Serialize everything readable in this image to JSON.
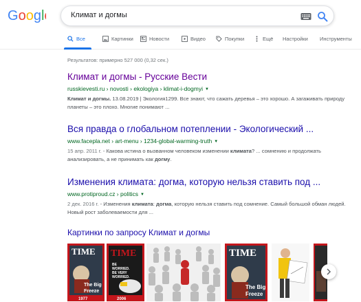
{
  "search": {
    "query": "Климат и догмы"
  },
  "tabs": [
    {
      "label": "Все",
      "icon": "search-icon"
    },
    {
      "label": "Картинки",
      "icon": "image-icon"
    },
    {
      "label": "Новости",
      "icon": "news-icon"
    },
    {
      "label": "Видео",
      "icon": "video-icon"
    },
    {
      "label": "Покупки",
      "icon": "tag-icon"
    },
    {
      "label": "Ещё",
      "icon": "more-icon"
    },
    {
      "label": "Настройки"
    },
    {
      "label": "Инструменты"
    }
  ],
  "stats": "Результатов: примерно 527 000 (0,32 сек.)",
  "results": [
    {
      "title": "Климат и догмы - Русские Вести",
      "url": "russkievesti.ru › novosti › ekologiya › klimat-i-dogmyi",
      "snippet_bold": "Климат и догмы.",
      "snippet": " 13.08.2019 | Экология1299. Все знают, что сажать деревья – это хорошо. А загаживать природу планеты – это плохо. Многие понимают ..."
    },
    {
      "title": "Вся правда о глобальном потеплении - Экологический ...",
      "url": "www.facepla.net › art-menu › 1234-global-warming-truth",
      "date": "15 апр. 2011 г.",
      "snippet_a": " - Какова истина о вызванном человеком изменении ",
      "snippet_bold1": "климата",
      "snippet_b": "? ... сомнению и продолжать анализировать, а не принимать как ",
      "snippet_bold2": "догму",
      "snippet_c": "."
    },
    {
      "title": "Изменения климата: догма, которую нельзя ставить под ...",
      "url": "www.protiproud.cz › politics",
      "date": "2 дек. 2016 г.",
      "snippet_a": " - Изменения ",
      "snippet_bold1": "климата",
      "snippet_b": ": ",
      "snippet_bold2": "догма",
      "snippet_c": ", которую нельзя ставить под сомнение. Самый большой обман людей. Новый рост заболеваемости для ..."
    }
  ],
  "images": {
    "heading": "Картинки по запросу Климат и догмы",
    "thumbs": [
      {
        "masthead": "TIME",
        "cover_text": "The Big Freeze",
        "year": "1977"
      },
      {
        "masthead": "TIME",
        "cover_text": "BE WORRIED. BE VERY WORRIED.",
        "year": "2006"
      },
      {
        "kind": "crowd"
      },
      {
        "masthead": "TIME",
        "cover_text": "The Big Freeze"
      },
      {
        "kind": "person"
      },
      {
        "masthead": "TIME"
      }
    ]
  },
  "colors": {
    "link": "#1a0dab",
    "visited": "#660099",
    "url": "#006621",
    "accent": "#1a73e8"
  }
}
